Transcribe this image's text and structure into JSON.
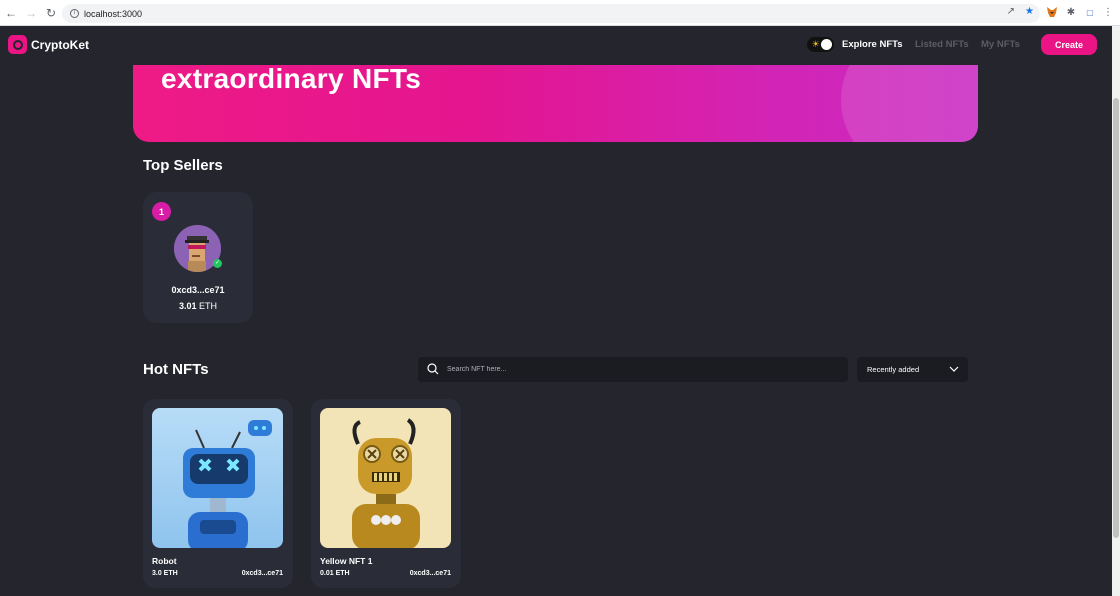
{
  "browser": {
    "url": "localhost:3000"
  },
  "navbar": {
    "brand": "CryptoKet",
    "links": [
      "Explore NFTs",
      "Listed NFTs",
      "My NFTs"
    ],
    "create_label": "Create",
    "colors": {
      "accent": "#eb1484",
      "background": "#24252d",
      "inactive_link": "#5c5d66"
    }
  },
  "hero": {
    "title": "extraordinary NFTs"
  },
  "top_sellers": {
    "title": "Top Sellers",
    "sellers": [
      {
        "rank": "1",
        "address": "0xcd3...ce71",
        "amount": "3.01",
        "currency": "ETH"
      }
    ]
  },
  "hot_nfts": {
    "title": "Hot NFTs",
    "search_placeholder": "Search NFT here...",
    "sort_selected": "Recently added",
    "items": [
      {
        "name": "Robot",
        "price": "3.0 ETH",
        "owner": "0xcd3...ce71"
      },
      {
        "name": "Yellow NFT 1",
        "price": "0.01 ETH",
        "owner": "0xcd3...ce71"
      }
    ]
  }
}
